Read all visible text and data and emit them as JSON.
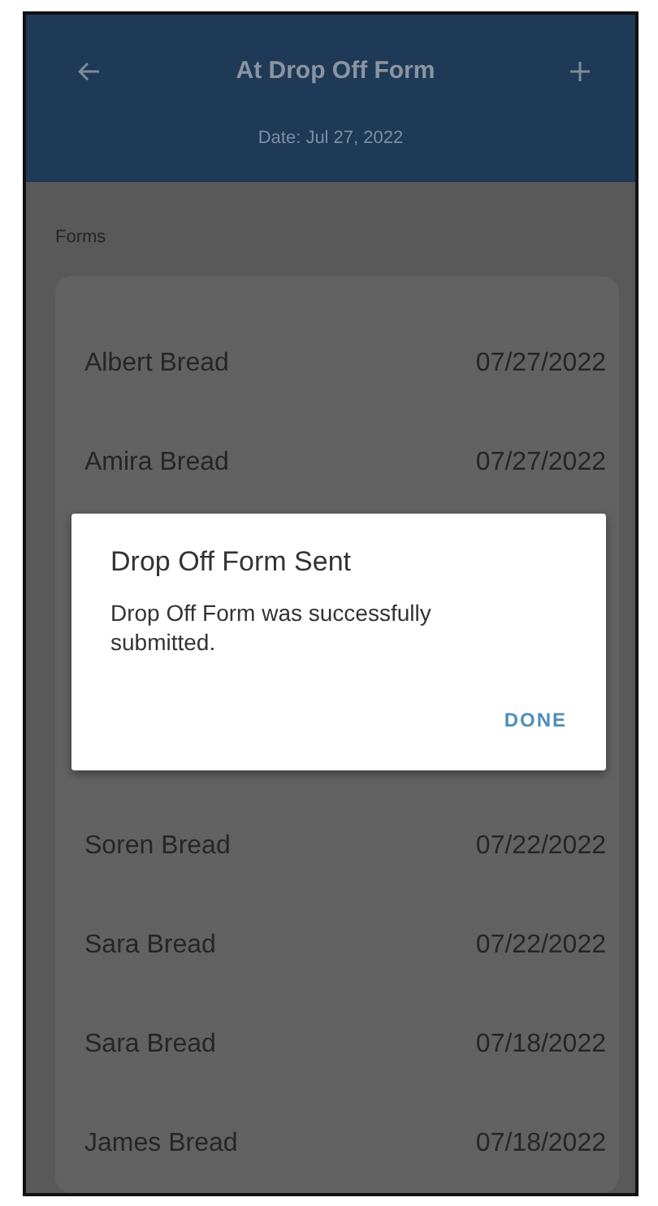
{
  "header": {
    "title": "At Drop Off Form",
    "subtitle": "Date: Jul 27, 2022"
  },
  "section_title": "Forms",
  "rows_above": [
    {
      "name": "Albert Bread",
      "date": "07/27/2022"
    },
    {
      "name": "Amira Bread",
      "date": "07/27/2022"
    }
  ],
  "dialog": {
    "title": "Drop Off Form Sent",
    "message": "Drop Off Form was successfully submitted.",
    "button": "DONE"
  },
  "rows_below": [
    {
      "name": "Soren Bread",
      "date": "07/22/2022"
    },
    {
      "name": "Sara Bread",
      "date": "07/22/2022"
    },
    {
      "name": "Sara Bread",
      "date": "07/18/2022"
    },
    {
      "name": "James Bread",
      "date": "07/18/2022"
    }
  ]
}
